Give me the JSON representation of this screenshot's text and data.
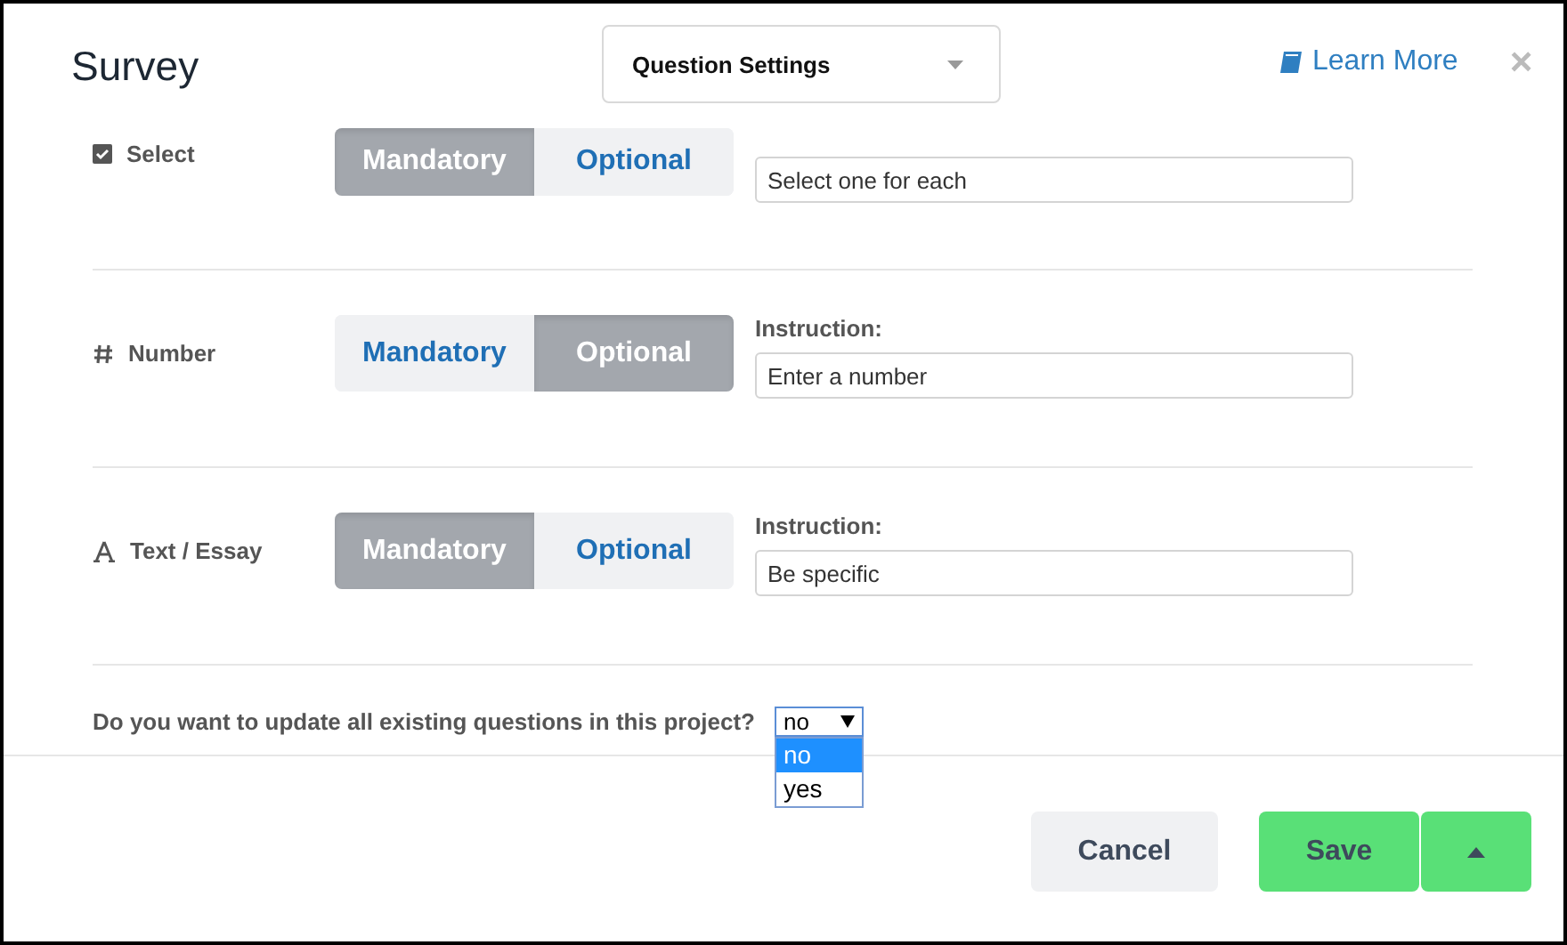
{
  "window": {
    "title": "Survey"
  },
  "settings_dropdown": {
    "value": "Question Settings"
  },
  "learn_more": "Learn More",
  "close": "×",
  "question_types": [
    {
      "kind": "select",
      "label": "Select",
      "options": [
        {
          "label": "Mandatory",
          "selected": true
        },
        {
          "label": "Optional",
          "selected": false
        }
      ],
      "instruction": {
        "value": "Select one for each"
      }
    },
    {
      "kind": "number",
      "label": "Number",
      "options": [
        {
          "label": "Mandatory",
          "selected": false
        },
        {
          "label": "Optional",
          "selected": true
        }
      ],
      "instruction": {
        "label": "Instruction:",
        "value": "Enter a number"
      }
    },
    {
      "kind": "text",
      "label": "Text / Essay",
      "options": [
        {
          "label": "Mandatory",
          "selected": true
        },
        {
          "label": "Optional",
          "selected": false
        }
      ],
      "instruction": {
        "label": "Instruction:",
        "value": "Be specific"
      }
    }
  ],
  "update_existing": {
    "question": "Do you want to update all existing questions in this project?",
    "value": "no",
    "expanded": true,
    "options": [
      {
        "label": "no",
        "selected": true
      },
      {
        "label": "yes",
        "selected": false
      }
    ]
  },
  "buttons": {
    "cancel": "Cancel",
    "save": "Save"
  }
}
